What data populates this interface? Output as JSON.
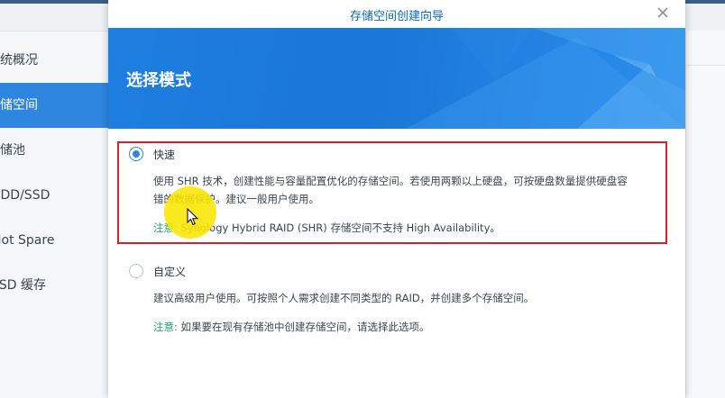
{
  "background": {
    "sidebar": {
      "items": [
        {
          "label": "系统概况"
        },
        {
          "label": "存储空间"
        },
        {
          "label": "存储池"
        },
        {
          "label": "HDD/SSD"
        },
        {
          "label": "Hot Spare"
        },
        {
          "label": "SSD 缓存"
        }
      ],
      "active_index": 1
    }
  },
  "modal": {
    "title": "存储空间创建向导",
    "close_icon": "close-icon",
    "banner_title": "选择模式",
    "options": [
      {
        "label": "快速",
        "selected": true,
        "description_line1": "使用 SHR 技术，创建性能与容量配置优化的存储空间。若使用两颗以上硬盘，可按硬盘数量提供硬盘容",
        "description_line2": "错的数据保护。建议一般用户使用。",
        "note_key": "注意:",
        "note_text": "Synology Hybrid RAID (SHR) 存储空间不支持 High Availability。"
      },
      {
        "label": "自定义",
        "selected": false,
        "description_line1": "建议高级用户使用。可按照个人需求创建不同类型的 RAID，并创建多个存储空间。",
        "note_key": "注意:",
        "note_text": "如果要在现有存储池中创建存储空间，请选择此选项。"
      }
    ]
  },
  "colors": {
    "accent": "#2f86e0",
    "highlight_border": "#d8202a",
    "note_green": "#21a56f",
    "banner_blue": "#1e7fe1"
  }
}
